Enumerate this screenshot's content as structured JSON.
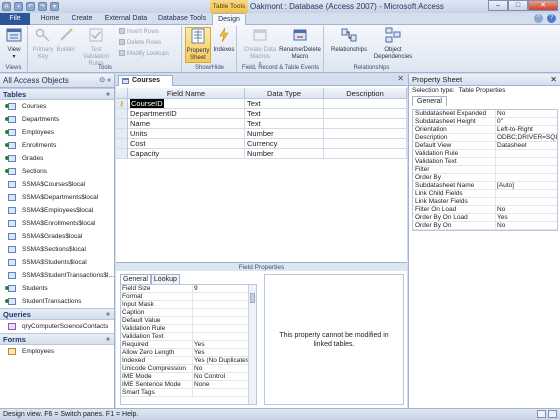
{
  "window": {
    "title": "Oakmont : Database (Access 2007)  -  Microsoft Access",
    "context_tab_group": "Table Tools",
    "controls": {
      "minimize": "–",
      "maximize": "□",
      "close": "✕"
    }
  },
  "tabs": [
    {
      "id": "file",
      "label": "File"
    },
    {
      "id": "home",
      "label": "Home"
    },
    {
      "id": "create",
      "label": "Create"
    },
    {
      "id": "external",
      "label": "External Data"
    },
    {
      "id": "dbtools",
      "label": "Database Tools"
    },
    {
      "id": "design",
      "label": "Design"
    }
  ],
  "ribbon": {
    "groups": {
      "views": "Views",
      "tools": "Tools",
      "show_hide": "Show/Hide",
      "field_events": "Field, Record & Table Events",
      "relationships": "Relationships"
    },
    "buttons": {
      "view": "View",
      "primary_key": "Primary Key",
      "builder": "Builder",
      "test_validation": "Test Validation Rules",
      "insert_rows": "Insert Rows",
      "delete_rows": "Delete Rows",
      "modify_lookups": "Modify Lookups",
      "property_sheet": "Property Sheet",
      "indexes": "Indexes",
      "create_data_macros": "Create Data Macros",
      "rename_delete_macro": "Rename/Delete Macro",
      "relationships": "Relationships",
      "object_dependencies": "Object Dependencies"
    }
  },
  "navpane": {
    "header": "All Access Objects",
    "groups": [
      {
        "label": "Tables",
        "items": [
          {
            "label": "Courses",
            "linked": true
          },
          {
            "label": "Departments",
            "linked": true
          },
          {
            "label": "Employees",
            "linked": true
          },
          {
            "label": "Enrollments",
            "linked": true
          },
          {
            "label": "Grades",
            "linked": true
          },
          {
            "label": "Sections",
            "linked": true
          },
          {
            "label": "SSMA$Courses$local",
            "linked": false
          },
          {
            "label": "SSMA$Departments$local",
            "linked": false
          },
          {
            "label": "SSMA$Employees$local",
            "linked": false
          },
          {
            "label": "SSMA$Enrollments$local",
            "linked": false
          },
          {
            "label": "SSMA$Grades$local",
            "linked": false
          },
          {
            "label": "SSMA$Sections$local",
            "linked": false
          },
          {
            "label": "SSMA$Students$local",
            "linked": false
          },
          {
            "label": "SSMA$StudentTransactions$l...",
            "linked": false
          },
          {
            "label": "Students",
            "linked": true
          },
          {
            "label": "StudentTransactions",
            "linked": true
          }
        ]
      },
      {
        "label": "Queries",
        "items": [
          {
            "label": "qryComputerScienceContacts",
            "linked": false
          }
        ]
      },
      {
        "label": "Forms",
        "items": [
          {
            "label": "Employees",
            "linked": false
          }
        ]
      }
    ]
  },
  "document": {
    "tab_label": "Courses",
    "columns": [
      "Field Name",
      "Data Type",
      "Description"
    ],
    "fields": [
      {
        "name": "CourseID",
        "type": "Text",
        "description": ""
      },
      {
        "name": "DepartmentID",
        "type": "Text",
        "description": ""
      },
      {
        "name": "Name",
        "type": "Text",
        "description": ""
      },
      {
        "name": "Units",
        "type": "Number",
        "description": ""
      },
      {
        "name": "Cost",
        "type": "Currency",
        "description": ""
      },
      {
        "name": "Capacity",
        "type": "Number",
        "description": ""
      }
    ]
  },
  "field_properties": {
    "label": "Field Properties",
    "tabs": [
      "General",
      "Lookup"
    ],
    "rows": [
      {
        "name": "Field Size",
        "value": "9"
      },
      {
        "name": "Format",
        "value": ""
      },
      {
        "name": "Input Mask",
        "value": ""
      },
      {
        "name": "Caption",
        "value": ""
      },
      {
        "name": "Default Value",
        "value": ""
      },
      {
        "name": "Validation Rule",
        "value": ""
      },
      {
        "name": "Validation Text",
        "value": ""
      },
      {
        "name": "Required",
        "value": "Yes"
      },
      {
        "name": "Allow Zero Length",
        "value": "Yes"
      },
      {
        "name": "Indexed",
        "value": "Yes (No Duplicates)"
      },
      {
        "name": "Unicode Compression",
        "value": "No"
      },
      {
        "name": "IME Mode",
        "value": "No Control"
      },
      {
        "name": "IME Sentence Mode",
        "value": "None"
      },
      {
        "name": "Smart Tags",
        "value": ""
      }
    ],
    "help_text": "This property cannot be modified in linked tables."
  },
  "property_sheet": {
    "title": "Property Sheet",
    "selection_label": "Selection type:",
    "selection_value": "Table Properties",
    "tab": "General",
    "rows": [
      {
        "name": "Subdatasheet Expanded",
        "value": "No"
      },
      {
        "name": "Subdatasheet Height",
        "value": "0\""
      },
      {
        "name": "Orientation",
        "value": "Left-to-Right"
      },
      {
        "name": "Description",
        "value": "ODBC;DRIVER=SQL Se"
      },
      {
        "name": "Default View",
        "value": "Datasheet"
      },
      {
        "name": "Validation Rule",
        "value": ""
      },
      {
        "name": "Validation Text",
        "value": ""
      },
      {
        "name": "Filter",
        "value": ""
      },
      {
        "name": "Order By",
        "value": ""
      },
      {
        "name": "Subdatasheet Name",
        "value": "[Auto]"
      },
      {
        "name": "Link Child Fields",
        "value": ""
      },
      {
        "name": "Link Master Fields",
        "value": ""
      },
      {
        "name": "Filter On Load",
        "value": "No"
      },
      {
        "name": "Order By On Load",
        "value": "Yes"
      },
      {
        "name": "Order By On",
        "value": "No"
      }
    ]
  },
  "statusbar": {
    "text": "Design view.  F6 = Switch panes.  F1 = Help."
  },
  "colors": {
    "file_tab": "#2b579a",
    "context_tab": "#f0c14b",
    "selection": "#000000"
  }
}
